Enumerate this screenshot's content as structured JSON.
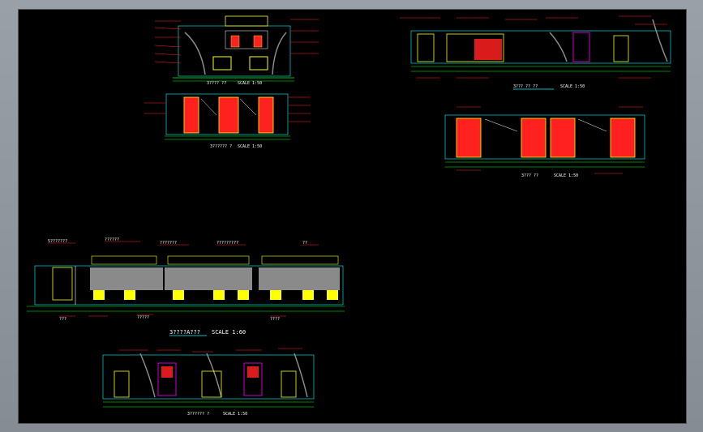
{
  "app": {
    "canvas_background": "#000000",
    "chrome_background": "#8e949c"
  },
  "colors": {
    "red": "#ff2020",
    "yellow": "#ffff00",
    "cyan": "#00ffff",
    "green": "#00ff00",
    "white": "#ffffff",
    "magenta": "#ff00ff",
    "gray": "#8a8a8a",
    "blue": "#3a7bff"
  },
  "drawings": {
    "top_left_a": {
      "title": "3???? ??",
      "scale": "SCALE  1:50"
    },
    "top_left_b": {
      "title": "3?????? ?",
      "scale": "SCALE  1:50"
    },
    "top_right_a": {
      "title": "3??? ?? ??",
      "scale": "SCALE  1:50"
    },
    "top_right_b": {
      "title": "3??? ??",
      "scale": "SCALE  1:50"
    },
    "mid_left": {
      "title": "3????A???",
      "scale": "SCALE  1:60",
      "callouts": [
        "5???????",
        "??????",
        "???????",
        "?????????",
        "????????",
        "??",
        "???",
        "???",
        "?????",
        "????",
        "????"
      ]
    },
    "bottom": {
      "title": "3?????? ?",
      "scale": "SCALE  1:50"
    }
  }
}
